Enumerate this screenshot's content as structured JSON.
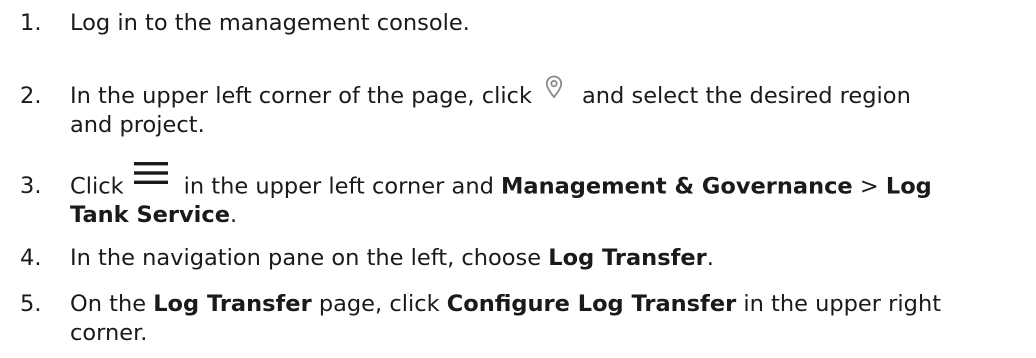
{
  "steps": [
    {
      "number": "1.",
      "text": "Log in to the management console."
    },
    {
      "number": "2.",
      "before_icon": "In the upper left corner of the page, click",
      "icon": "location-pin-icon",
      "after_icon": "and select the desired region",
      "line2": "and project."
    },
    {
      "number": "3.",
      "before_icon": "Click",
      "icon": "hamburger-menu-icon",
      "after_icon": "in the upper left corner and",
      "bold1": "Management & Governance",
      "separator": ">",
      "bold2a": "Log",
      "bold2b": "Tank Service",
      "end": "."
    },
    {
      "number": "4.",
      "text": "In the navigation pane on the left, choose",
      "bold": "Log Transfer",
      "end": "."
    },
    {
      "number": "5.",
      "t1": "On the",
      "b1": "Log Transfer",
      "t2": "page, click",
      "b2": "Configure Log Transfer",
      "t3": "in the upper right",
      "line2": "corner."
    }
  ],
  "colors": {
    "text": "#1a1a1a",
    "icon": "#8a8a8a",
    "menu_icon": "#1a1a1a"
  }
}
